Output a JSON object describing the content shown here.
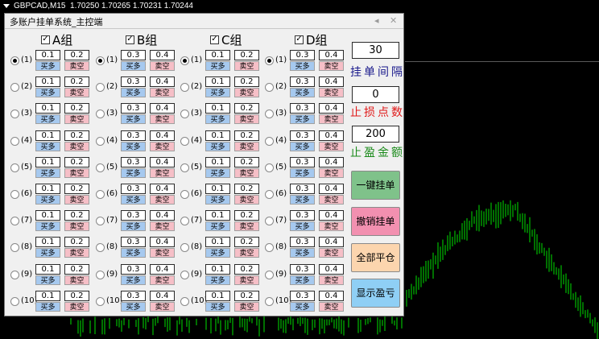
{
  "chart": {
    "symbol": "GBPCAD,M15",
    "quotes": "1.70250 1.70265 1.70231 1.70244"
  },
  "panel": {
    "title": "多账户挂单系统_主控端",
    "pin_icon": "◂",
    "close_icon": "✕",
    "groups": [
      {
        "label": "A组",
        "checked": true
      },
      {
        "label": "B组",
        "checked": true
      },
      {
        "label": "C组",
        "checked": true
      },
      {
        "label": "D组",
        "checked": true
      }
    ],
    "check_mark": "✓",
    "buy_label": "买多",
    "sell_label": "卖空",
    "row_labels": [
      "(1)",
      "(2)",
      "(3)",
      "(4)",
      "(5)",
      "(6)",
      "(7)",
      "(8)",
      "(9)",
      "(10)"
    ],
    "group_values": [
      {
        "buy": "0.1",
        "sell": "0.2"
      },
      {
        "buy": "0.3",
        "sell": "0.4"
      },
      {
        "buy": "0.1",
        "sell": "0.2"
      },
      {
        "buy": "0.3",
        "sell": "0.4"
      }
    ],
    "selected_row": 0
  },
  "right": {
    "interval_value": "30",
    "interval_label": "挂单间隔",
    "stoploss_value": "0",
    "stoploss_label": "止损点数",
    "takeprofit_value": "200",
    "takeprofit_label": "止盈金额",
    "colors": {
      "interval": "#1a1a8c",
      "stoploss": "#e01a1a",
      "takeprofit": "#1a8a1a"
    },
    "buttons": [
      {
        "label": "一键挂单",
        "color": "#7fc28a"
      },
      {
        "label": "撤销挂单",
        "color": "#f290b0"
      },
      {
        "label": "全部平仓",
        "color": "#fcd5ae"
      },
      {
        "label": "显示盈亏",
        "color": "#8fcff5"
      }
    ]
  }
}
